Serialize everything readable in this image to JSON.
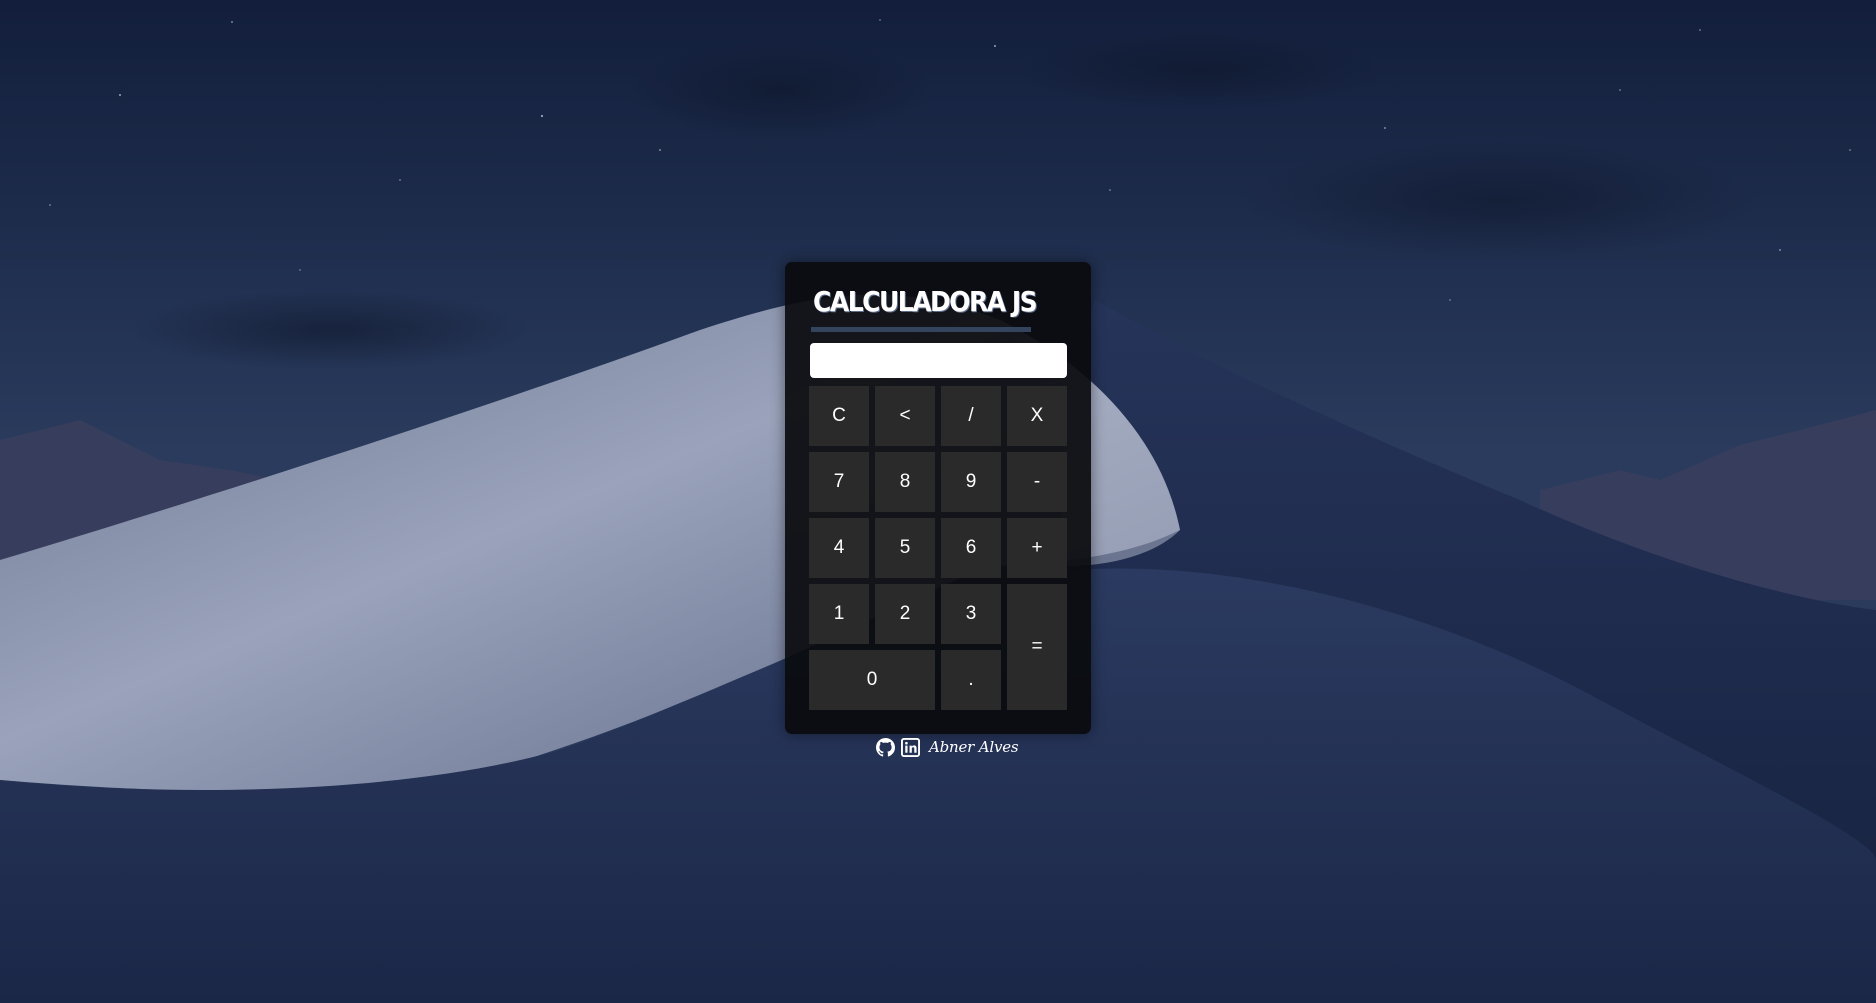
{
  "calculator": {
    "title": "CALCULADORA JS",
    "display_value": "",
    "keys": {
      "clear": "C",
      "backspace": "<",
      "divide": "/",
      "multiply": "X",
      "seven": "7",
      "eight": "8",
      "nine": "9",
      "subtract": "-",
      "four": "4",
      "five": "5",
      "six": "6",
      "add": "+",
      "one": "1",
      "two": "2",
      "three": "3",
      "equals": "=",
      "zero": "0",
      "decimal": "."
    }
  },
  "footer": {
    "author": "Abner Alves",
    "icons": [
      "github-icon",
      "linkedin-icon"
    ]
  },
  "colors": {
    "panel": "#0a0b0e",
    "key": "#2a2a2a",
    "key_text": "#ffffff",
    "title_underline": "#34435e",
    "display": "#ffffff"
  }
}
